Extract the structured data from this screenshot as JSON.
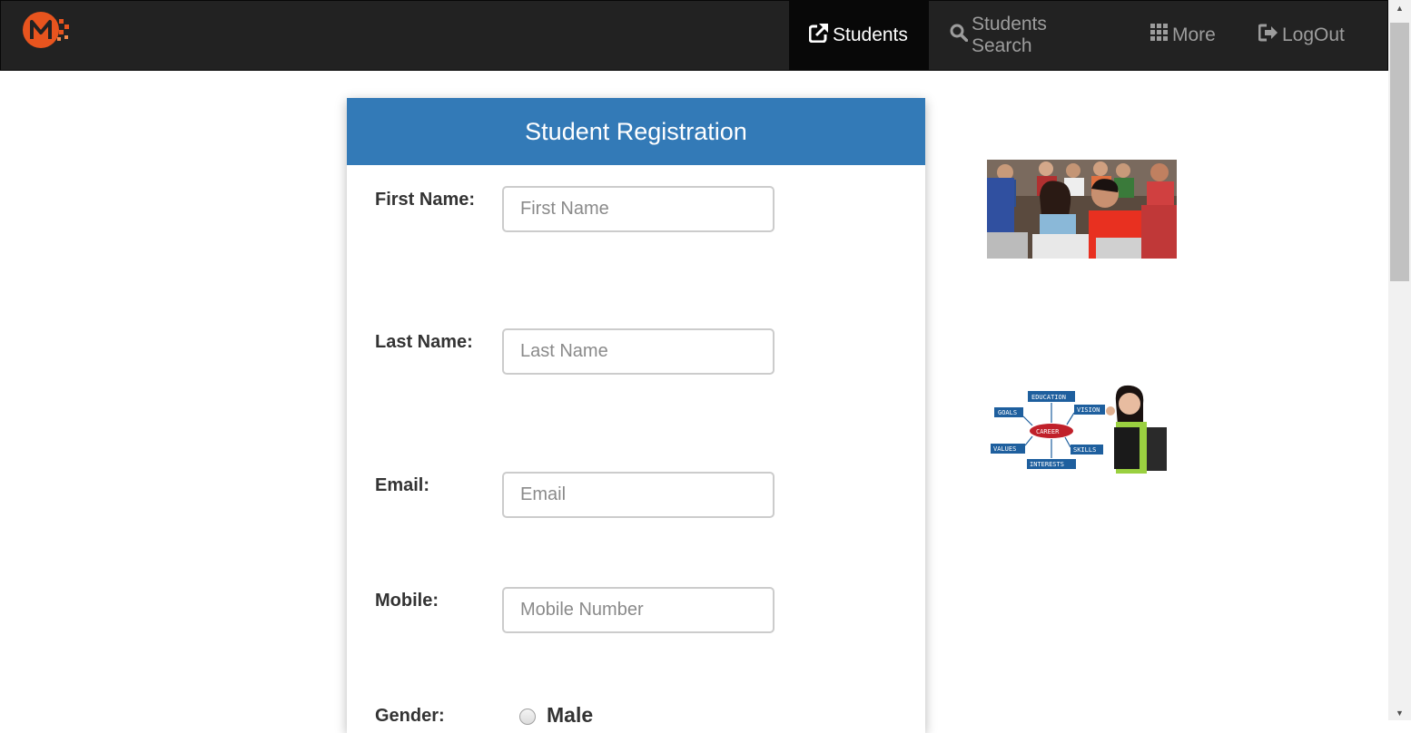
{
  "nav": {
    "logo_icon": "m-logo-icon",
    "items": [
      {
        "label": "Students",
        "icon": "external-link-icon",
        "active": true
      },
      {
        "label": "Students Search",
        "icon": "search-icon",
        "active": false
      },
      {
        "label": "More",
        "icon": "grid-icon",
        "active": false
      },
      {
        "label": "LogOut",
        "icon": "logout-icon",
        "active": false
      }
    ]
  },
  "form": {
    "title": "Student Registration",
    "fields": [
      {
        "label": "First Name:",
        "placeholder": "First Name",
        "value": ""
      },
      {
        "label": "Last Name:",
        "placeholder": "Last Name",
        "value": ""
      },
      {
        "label": "Email:",
        "placeholder": "Email",
        "value": ""
      },
      {
        "label": "Mobile:",
        "placeholder": "Mobile Number",
        "value": ""
      }
    ],
    "gender": {
      "label": "Gender:",
      "options": [
        "Male"
      ]
    }
  },
  "career_diagram": {
    "center": "CAREER",
    "nodes": [
      "EDUCATION",
      "GOALS",
      "VISION",
      "VALUES",
      "SKILLS",
      "INTERESTS"
    ]
  },
  "colors": {
    "navbar_bg": "#222222",
    "nav_active_bg": "#080808",
    "card_header_bg": "#337ab7",
    "logo_orange": "#e8541e"
  }
}
